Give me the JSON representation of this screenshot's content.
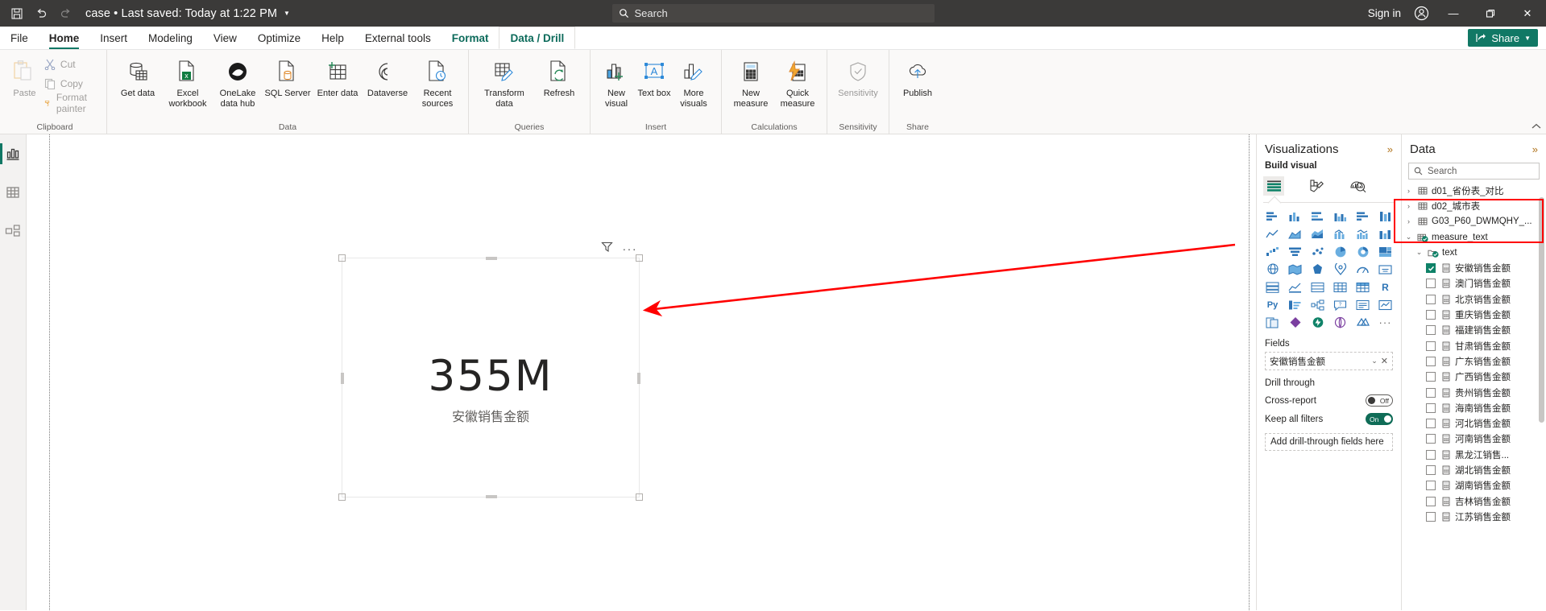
{
  "titlebar": {
    "save_icon": "save-icon",
    "undo_icon": "undo-icon",
    "redo_icon": "redo-icon",
    "document_title": "case • Last saved: Today at 1:22 PM",
    "search_placeholder": "Search",
    "sign_in": "Sign in",
    "minimize": "—",
    "restore": "❐",
    "close": "✕"
  },
  "menubar": {
    "items": [
      {
        "label": "File",
        "state": "normal"
      },
      {
        "label": "Home",
        "state": "active"
      },
      {
        "label": "Insert",
        "state": "normal"
      },
      {
        "label": "Modeling",
        "state": "normal"
      },
      {
        "label": "View",
        "state": "normal"
      },
      {
        "label": "Optimize",
        "state": "normal"
      },
      {
        "label": "Help",
        "state": "normal"
      },
      {
        "label": "External tools",
        "state": "normal"
      },
      {
        "label": "Format",
        "state": "contextual"
      },
      {
        "label": "Data / Drill",
        "state": "contextual-selected"
      }
    ],
    "share_label": "Share"
  },
  "ribbon": {
    "groups": [
      {
        "name": "Clipboard",
        "label": "Clipboard",
        "big": [
          {
            "label": "Paste",
            "icon": "paste-icon",
            "disabled": true
          }
        ],
        "small": [
          {
            "label": "Cut",
            "icon": "cut-icon"
          },
          {
            "label": "Copy",
            "icon": "copy-icon"
          },
          {
            "label": "Format painter",
            "icon": "format-painter-icon"
          }
        ]
      },
      {
        "name": "Data",
        "label": "Data",
        "big": [
          {
            "label": "Get data",
            "icon": "get-data-icon",
            "caret": true
          },
          {
            "label": "Excel workbook",
            "icon": "excel-icon"
          },
          {
            "label": "OneLake data hub",
            "icon": "onelake-icon",
            "caret": true
          },
          {
            "label": "SQL Server",
            "icon": "sql-server-icon"
          },
          {
            "label": "Enter data",
            "icon": "enter-data-icon"
          },
          {
            "label": "Dataverse",
            "icon": "dataverse-icon"
          },
          {
            "label": "Recent sources",
            "icon": "recent-sources-icon",
            "caret": true
          }
        ]
      },
      {
        "name": "Queries",
        "label": "Queries",
        "big": [
          {
            "label": "Transform data",
            "icon": "transform-data-icon",
            "caret": true
          },
          {
            "label": "Refresh",
            "icon": "refresh-icon"
          }
        ]
      },
      {
        "name": "Insert",
        "label": "Insert",
        "big": [
          {
            "label": "New visual",
            "icon": "new-visual-icon"
          },
          {
            "label": "Text box",
            "icon": "text-box-icon"
          },
          {
            "label": "More visuals",
            "icon": "more-visuals-icon",
            "caret": true
          }
        ]
      },
      {
        "name": "Calculations",
        "label": "Calculations",
        "big": [
          {
            "label": "New measure",
            "icon": "new-measure-icon"
          },
          {
            "label": "Quick measure",
            "icon": "quick-measure-icon"
          }
        ]
      },
      {
        "name": "Sensitivity",
        "label": "Sensitivity",
        "big": [
          {
            "label": "Sensitivity",
            "icon": "sensitivity-icon",
            "caret": true,
            "disabled": true
          }
        ]
      },
      {
        "name": "Share",
        "label": "Share",
        "big": [
          {
            "label": "Publish",
            "icon": "publish-icon"
          }
        ]
      }
    ],
    "collapse_icon": "chevron-up-icon"
  },
  "leftrail": {
    "items": [
      {
        "name": "report-view",
        "icon": "report-bar-chart-icon",
        "active": true
      },
      {
        "name": "table-view",
        "icon": "table-grid-icon",
        "active": false
      },
      {
        "name": "model-view",
        "icon": "model-relationship-icon",
        "active": false
      }
    ]
  },
  "canvas": {
    "visual": {
      "value": "355M",
      "label": "安徽销售金额",
      "filter_icon": "filter-icon",
      "more_icon": "more-options-icon"
    }
  },
  "visualizations": {
    "title": "Visualizations",
    "expand_icon": "chevron-double-right-icon",
    "build_visual": "Build visual",
    "tabs": [
      {
        "name": "build-visual-tab",
        "icon": "build-visual-icon",
        "selected": true
      },
      {
        "name": "format-visual-tab",
        "icon": "format-paintbrush-icon",
        "selected": false
      },
      {
        "name": "analytics-tab",
        "icon": "analytics-magnifier-icon",
        "selected": false
      }
    ],
    "gallery": [
      "stacked-bar-chart",
      "stacked-column-chart",
      "clustered-bar-chart",
      "clustered-column-chart",
      "100-stacked-bar-chart",
      "100-stacked-column-chart",
      "line-chart",
      "area-chart",
      "stacked-area-chart",
      "line-stacked-column-chart",
      "line-clustered-column-chart",
      "ribbon-chart",
      "waterfall-chart",
      "funnel-chart",
      "scatter-chart",
      "pie-chart",
      "donut-chart",
      "treemap",
      "map",
      "filled-map",
      "shape-map",
      "azure-map",
      "gauge",
      "card",
      "multi-row-card",
      "kpi",
      "slicer",
      "table",
      "matrix",
      "r-visual",
      "python-visual",
      "key-influencers",
      "decomposition-tree",
      "qa-visual",
      "smart-narrative",
      "metrics",
      "paginated-report",
      "power-apps",
      "power-automate",
      "arcgis-maps",
      "azure-ml",
      "more-options"
    ],
    "fields_label": "Fields",
    "field_chip": "安徽销售金额",
    "field_chevron_icon": "chevron-down-icon",
    "field_remove_icon": "close-icon",
    "drill_through_label": "Drill through",
    "cross_report_label": "Cross-report",
    "cross_report_state": "Off",
    "keep_filters_label": "Keep all filters",
    "keep_filters_state": "On",
    "drop_zone_label": "Add drill-through fields here"
  },
  "data": {
    "title": "Data",
    "expand_icon": "chevron-double-right-icon",
    "search_placeholder": "Search",
    "search_icon": "search-icon",
    "tree": [
      {
        "label": "d01_省份表_对比",
        "indent": 0,
        "chevron": "collapsed",
        "icon": "table-icon",
        "type": "table"
      },
      {
        "label": "d02_城市表",
        "indent": 0,
        "chevron": "collapsed",
        "icon": "table-icon",
        "type": "table"
      },
      {
        "label": "G03_P60_DWMQHY_...",
        "indent": 0,
        "chevron": "collapsed",
        "icon": "table-icon",
        "type": "table"
      },
      {
        "label": "measure_text",
        "indent": 0,
        "chevron": "expanded",
        "icon": "table-measure-icon",
        "type": "table",
        "highlight": true
      },
      {
        "label": "text",
        "indent": 1,
        "chevron": "expanded",
        "icon": "folder-measure-icon",
        "type": "folder",
        "highlight": true
      },
      {
        "label": "安徽销售金额",
        "indent": 2,
        "checked": true,
        "icon": "measure-icon",
        "type": "measure",
        "highlight": true
      },
      {
        "label": "澳门销售金额",
        "indent": 2,
        "checked": false,
        "icon": "measure-icon",
        "type": "measure"
      },
      {
        "label": "北京销售金额",
        "indent": 2,
        "checked": false,
        "icon": "measure-icon",
        "type": "measure"
      },
      {
        "label": "重庆销售金额",
        "indent": 2,
        "checked": false,
        "icon": "measure-icon",
        "type": "measure"
      },
      {
        "label": "福建销售金额",
        "indent": 2,
        "checked": false,
        "icon": "measure-icon",
        "type": "measure"
      },
      {
        "label": "甘肃销售金额",
        "indent": 2,
        "checked": false,
        "icon": "measure-icon",
        "type": "measure"
      },
      {
        "label": "广东销售金额",
        "indent": 2,
        "checked": false,
        "icon": "measure-icon",
        "type": "measure"
      },
      {
        "label": "广西销售金额",
        "indent": 2,
        "checked": false,
        "icon": "measure-icon",
        "type": "measure"
      },
      {
        "label": "贵州销售金额",
        "indent": 2,
        "checked": false,
        "icon": "measure-icon",
        "type": "measure"
      },
      {
        "label": "海南销售金额",
        "indent": 2,
        "checked": false,
        "icon": "measure-icon",
        "type": "measure"
      },
      {
        "label": "河北销售金额",
        "indent": 2,
        "checked": false,
        "icon": "measure-icon",
        "type": "measure"
      },
      {
        "label": "河南销售金额",
        "indent": 2,
        "checked": false,
        "icon": "measure-icon",
        "type": "measure"
      },
      {
        "label": "黑龙江销售...",
        "indent": 2,
        "checked": false,
        "icon": "measure-icon",
        "type": "measure"
      },
      {
        "label": "湖北销售金额",
        "indent": 2,
        "checked": false,
        "icon": "measure-icon",
        "type": "measure"
      },
      {
        "label": "湖南销售金额",
        "indent": 2,
        "checked": false,
        "icon": "measure-icon",
        "type": "measure"
      },
      {
        "label": "吉林销售金额",
        "indent": 2,
        "checked": false,
        "icon": "measure-icon",
        "type": "measure"
      },
      {
        "label": "江苏销售金额",
        "indent": 2,
        "checked": false,
        "icon": "measure-icon",
        "type": "measure"
      }
    ]
  },
  "annotation": {
    "arrow_color": "#ff0000",
    "highlight_color": "#ff0000"
  },
  "colors": {
    "brand_green": "#117865",
    "titlebar": "#3b3a39",
    "ribbon_bg": "#faf9f8",
    "accent_checked": "#0f8268"
  }
}
